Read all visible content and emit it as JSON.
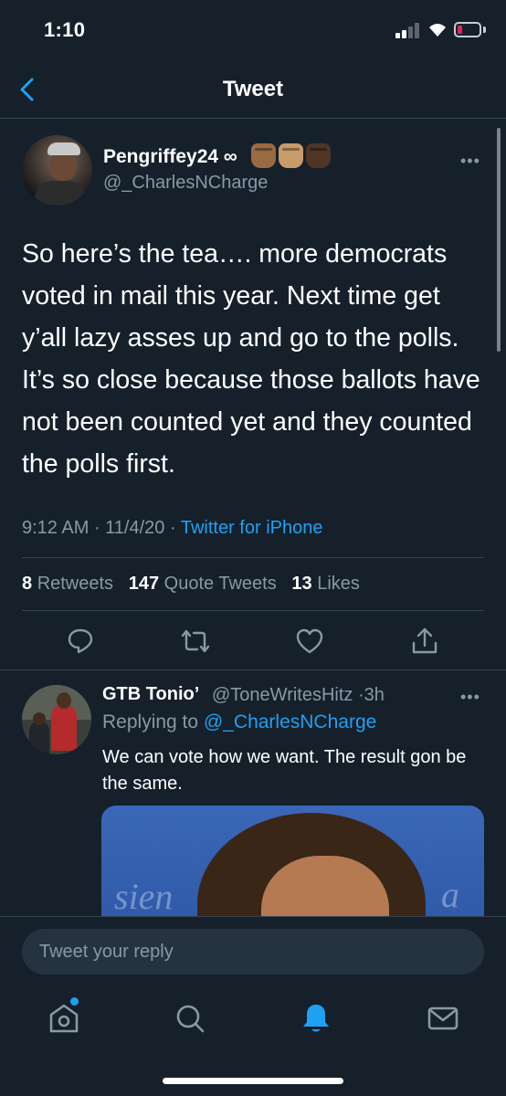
{
  "status_bar": {
    "time": "1:10"
  },
  "nav": {
    "title": "Tweet"
  },
  "tweet": {
    "author_name": "Pengriffey24 ∞",
    "author_handle": "@_CharlesNCharge",
    "text": "So here’s the tea…. more democrats voted in mail this year. Next time get y’all lazy asses up and go to the polls. It’s so close because those ballots have not been counted yet and they counted the polls first.",
    "time": "9:12 AM",
    "date": "11/4/20",
    "source": "Twitter for iPhone",
    "retweets_count": "8",
    "retweets_label": "Retweets",
    "quote_count": "147",
    "quote_label": "Quote Tweets",
    "likes_count": "13",
    "likes_label": "Likes"
  },
  "reply": {
    "author_name": "GTB Tonio’",
    "author_handle": "@ToneWritesHitz",
    "age": "3h",
    "replying_prefix": "Replying to",
    "replying_to": "@_CharlesNCharge",
    "text": "We can vote how we want. The result gon be the same.",
    "media_text_left": "sien",
    "media_text_right": "a"
  },
  "composer": {
    "placeholder": "Tweet your reply"
  },
  "colors": {
    "background": "#15202b",
    "accent": "#1da1f2",
    "muted": "#8899a6",
    "divider": "#38444d"
  },
  "icons": [
    "back-chevron-icon",
    "reply-icon",
    "retweet-icon",
    "like-icon",
    "share-icon",
    "home-icon",
    "search-icon",
    "notifications-bell-icon",
    "messages-envelope-icon"
  ]
}
